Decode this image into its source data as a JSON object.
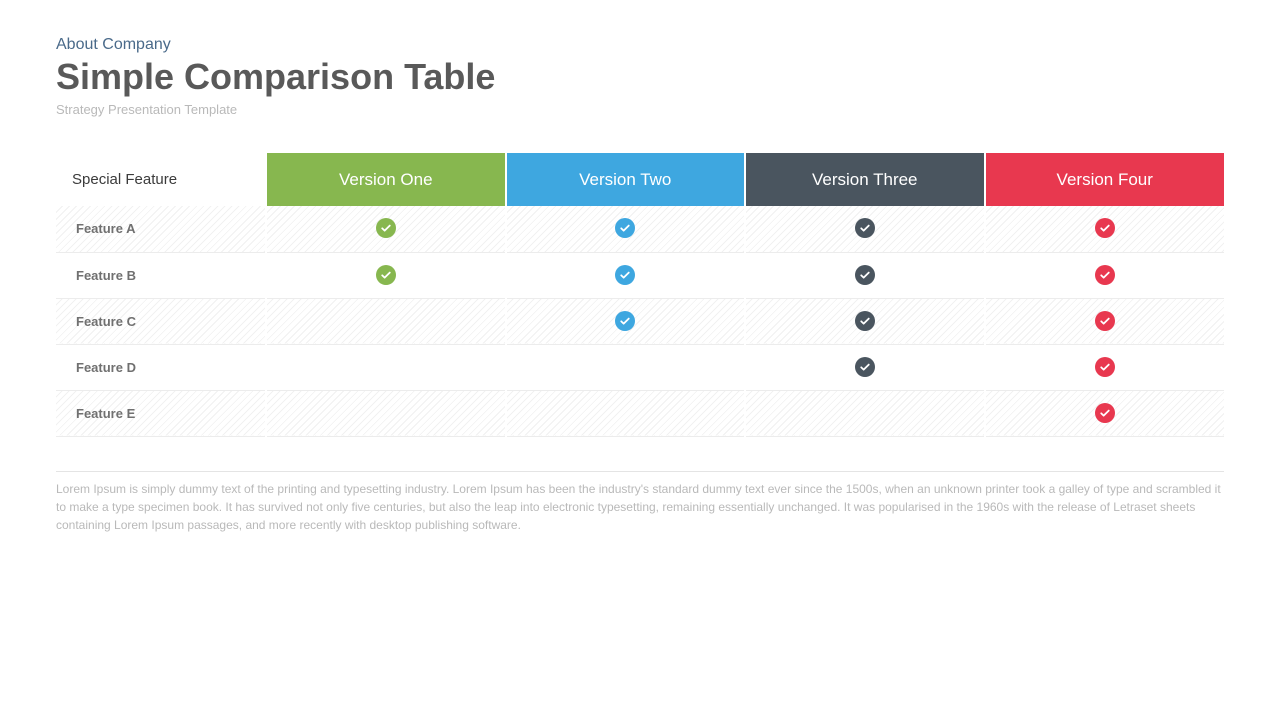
{
  "header": {
    "kicker": "About Company",
    "title": "Simple Comparison Table",
    "subtitle": "Strategy Presentation Template"
  },
  "table": {
    "corner_label": "Special Feature",
    "columns": [
      {
        "label": "Version One",
        "color": "#87b74f"
      },
      {
        "label": "Version Two",
        "color": "#3ea7e0"
      },
      {
        "label": "Version Three",
        "color": "#4a555f"
      },
      {
        "label": "Version Four",
        "color": "#e8384f"
      }
    ],
    "rows": [
      {
        "label": "Feature A",
        "cells": [
          true,
          true,
          true,
          true
        ]
      },
      {
        "label": "Feature B",
        "cells": [
          true,
          true,
          true,
          true
        ]
      },
      {
        "label": "Feature C",
        "cells": [
          false,
          true,
          true,
          true
        ]
      },
      {
        "label": "Feature D",
        "cells": [
          false,
          false,
          true,
          true
        ]
      },
      {
        "label": "Feature E",
        "cells": [
          false,
          false,
          false,
          true
        ]
      }
    ]
  },
  "footnote": "Lorem Ipsum is simply dummy text of the printing and typesetting industry. Lorem Ipsum has been the industry's standard dummy text ever since the 1500s, when an unknown printer took a galley of type and scrambled it to make a type specimen book. It has survived not only five centuries, but also the leap into electronic typesetting, remaining essentially unchanged. It was popularised in the 1960s with the release of Letraset sheets containing Lorem Ipsum passages, and more recently with desktop publishing software."
}
